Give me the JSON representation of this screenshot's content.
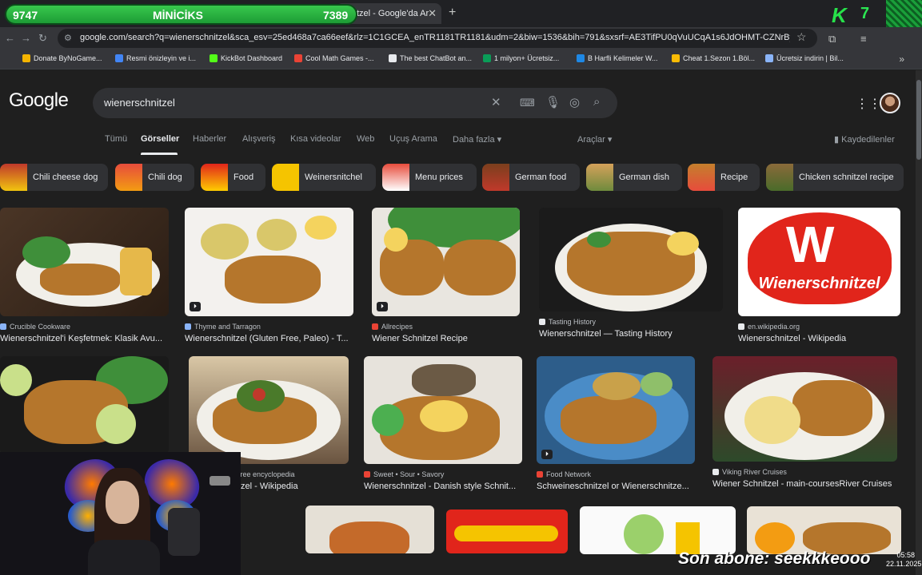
{
  "overlay": {
    "left_value": "9747",
    "label": "MİNİCİKS",
    "right_value": "7389",
    "k_count": "7",
    "last_sub": "Son abone: seekkkeooo",
    "time": "05:58",
    "date": "22.11.2025"
  },
  "browser": {
    "tab_title": "tzel - Google'da Ar",
    "url": "google.com/search?q=wienerschnitzel&sca_esv=25ed468a7ca66eef&rlz=1C1GCEA_enTR1181TR1181&udm=2&biw=1536&bih=791&sxsrf=AE3TifPU0qVuUCqA1s6JdOHMT-CZNrBywQ%...",
    "bookmarks": [
      "Donate ByNoGame...",
      "Resmi önizleyin ve i...",
      "KickBot Dashboard",
      "Cool Math Games -...",
      "The best ChatBot an...",
      "1 milyon+ Ücretsiz...",
      "B Harfli Kelimeler W...",
      "Cheat 1.Sezon 1.Böl...",
      "Ücretsiz indirin | Bil..."
    ]
  },
  "google": {
    "logo": "Google",
    "query": "wienerschnitzel",
    "tabs": [
      "Tümü",
      "Görseller",
      "Haberler",
      "Alışveriş",
      "Kısa videolar",
      "Web",
      "Uçuş Arama",
      "Daha fazla",
      "Araçlar"
    ],
    "saved": "Kaydedilenler",
    "chips": [
      "Chili cheese dog",
      "Chili dog",
      "Food",
      "Weinersnitchel",
      "Menu prices",
      "German food",
      "German dish",
      "Recipe",
      "Chicken schnitzel recipe"
    ],
    "row1": [
      {
        "source": "Crucible Cookware",
        "title": "Wienerschnitzel'i Keşfetmek: Klasik Avu..."
      },
      {
        "source": "Thyme and Tarragon",
        "title": "Wienerschnitzel (Gluten Free, Paleo) - T..."
      },
      {
        "source": "Allrecipes",
        "title": "Wiener Schnitzel Recipe"
      },
      {
        "source": "Tasting History",
        "title": "Wienerschnitzel — Tasting History"
      },
      {
        "source": "en.wikipedia.org",
        "title": "Wienerschnitzel - Wikipedia"
      }
    ],
    "row2": [
      {
        "source": "free encyclopedia",
        "title": "tzel - Wikipedia"
      },
      {
        "source": "Sweet • Sour • Savory",
        "title": "Wienerschnitzel - Danish style Schnit..."
      },
      {
        "source": "Food Network",
        "title": "Schweineschnitzel or Wienerschnitze..."
      },
      {
        "source": "Viking River Cruises",
        "title": "Wiener Schnitzel - main-coursesRiver Cruises"
      }
    ],
    "brand_logo_text": "Wienerschnitzel"
  },
  "colors": {
    "accent_green": "#2bd24a",
    "brand_red": "#e1251b",
    "page_bg": "#1f1f1f"
  }
}
